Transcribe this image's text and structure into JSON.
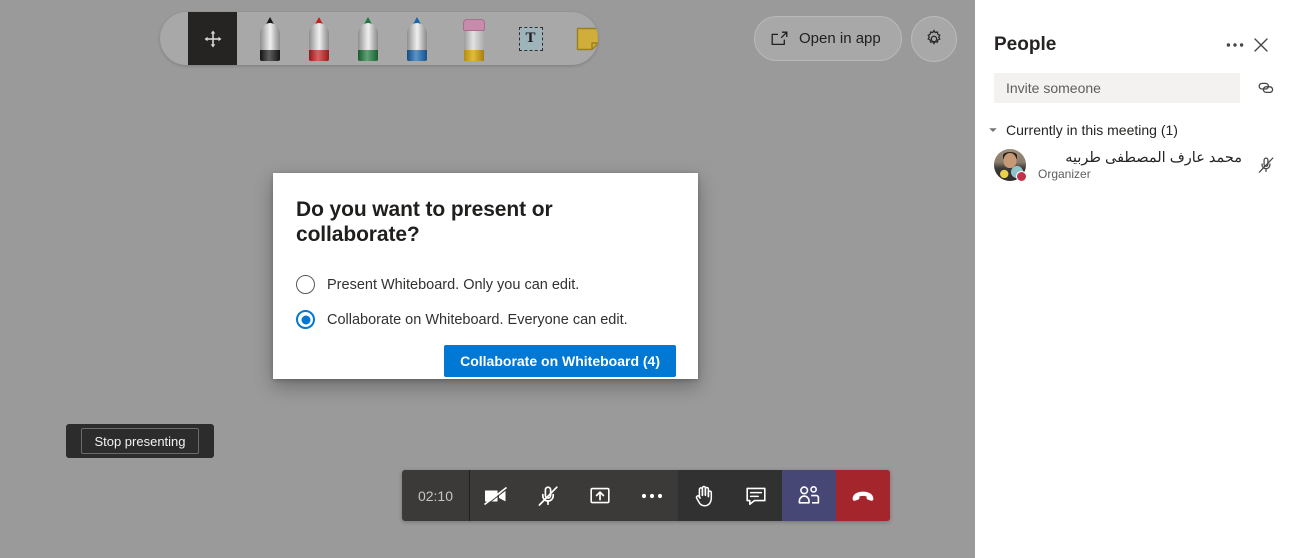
{
  "stage": {
    "background_color": "#9a9a9a",
    "toolbar": {
      "tools": [
        {
          "name": "move-tool",
          "icon": "move-icon",
          "selected": true
        },
        {
          "name": "pen-black",
          "icon": "pen-icon",
          "color": "#1a1a1a"
        },
        {
          "name": "pen-red",
          "icon": "pen-icon",
          "color": "#c4201f"
        },
        {
          "name": "pen-green",
          "icon": "pen-icon",
          "color": "#1b7a3d"
        },
        {
          "name": "pen-blue",
          "icon": "pen-icon",
          "color": "#1566b0"
        },
        {
          "name": "highlighter",
          "icon": "highlighter-icon",
          "color": "#d8a81f"
        },
        {
          "name": "text-tool",
          "icon": "text-icon",
          "label": "T"
        },
        {
          "name": "sticky-note-tool",
          "icon": "sticky-note-icon",
          "color": "#cfae3a"
        }
      ]
    },
    "open_in_app": {
      "label": "Open in app",
      "icon": "external-link-icon"
    },
    "settings": {
      "icon": "gear-icon"
    },
    "stop_presenting": {
      "label": "Stop presenting"
    }
  },
  "dialog": {
    "title": "Do you want to present or collaborate?",
    "options": [
      {
        "label": "Present Whiteboard. Only you can edit.",
        "selected": false
      },
      {
        "label": "Collaborate on Whiteboard. Everyone can edit.",
        "selected": true
      }
    ],
    "cta_label": "Collaborate on Whiteboard (4)",
    "accent_color": "#0078d4"
  },
  "controls": {
    "timer": "02:10",
    "buttons": [
      {
        "name": "camera-button",
        "icon": "camera-off-icon",
        "state": "off"
      },
      {
        "name": "mic-button",
        "icon": "mic-off-icon",
        "state": "off"
      },
      {
        "name": "share-button",
        "icon": "share-screen-icon",
        "state": "on"
      },
      {
        "name": "more-button",
        "icon": "ellipsis-icon",
        "state": "on"
      },
      {
        "name": "raise-hand-button",
        "icon": "hand-icon",
        "state": "on"
      },
      {
        "name": "chat-button",
        "icon": "chat-icon",
        "state": "on"
      },
      {
        "name": "people-button",
        "icon": "people-icon",
        "state": "active"
      },
      {
        "name": "hangup-button",
        "icon": "phone-hangup-icon",
        "state": "on"
      }
    ],
    "people_active_color": "#464775",
    "hangup_color": "#a4262c"
  },
  "panel": {
    "title": "People",
    "more_icon": "ellipsis-icon",
    "close_icon": "close-icon",
    "invite_placeholder": "Invite someone",
    "invite_value": "",
    "copy_link_icon": "link-icon",
    "section": {
      "label": "Currently in this meeting (1)",
      "chevron": "chevron-down-icon",
      "expanded": true
    },
    "participants": [
      {
        "name": "محمد عارف المصطفى طربيه",
        "role": "Organizer",
        "presence": "busy",
        "presence_color": "#c4314b",
        "mic_icon": "mic-off-icon"
      }
    ]
  }
}
